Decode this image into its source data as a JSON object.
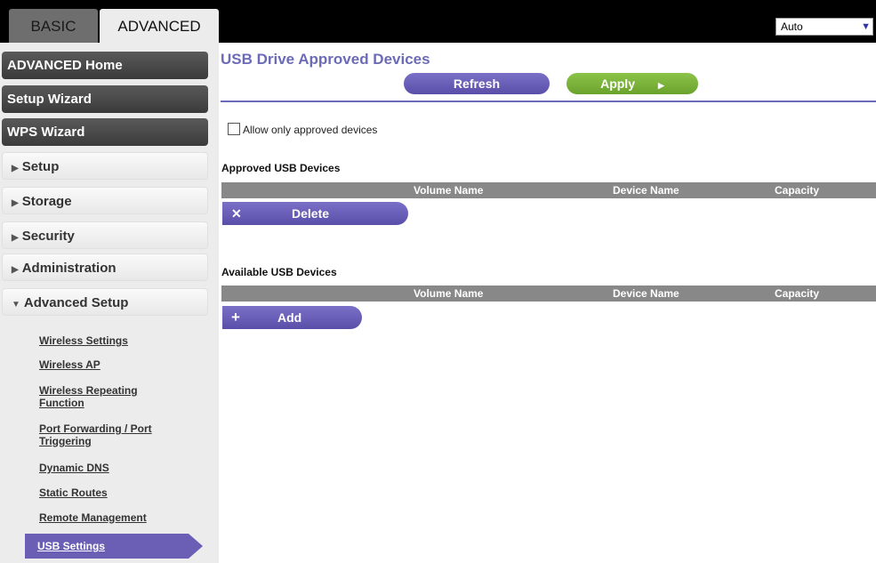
{
  "tabs": {
    "basic": "BASIC",
    "advanced": "ADVANCED"
  },
  "language": {
    "selected": "Auto"
  },
  "sidebar": {
    "advanced_home": "ADVANCED Home",
    "setup_wizard": "Setup Wizard",
    "wps_wizard": "WPS Wizard",
    "setup": "Setup",
    "storage": "Storage",
    "security": "Security",
    "administration": "Administration",
    "advanced_setup": "Advanced Setup",
    "submenu": {
      "wireless_settings": "Wireless Settings",
      "wireless_ap": "Wireless AP",
      "wireless_repeating": "Wireless Repeating Function",
      "port_forwarding": "Port Forwarding / Port Triggering",
      "dynamic_dns": "Dynamic DNS",
      "static_routes": "Static Routes",
      "remote_management": "Remote Management",
      "usb_settings": "USB Settings"
    }
  },
  "main": {
    "title": "USB Drive Approved Devices",
    "refresh": "Refresh",
    "apply": "Apply",
    "allow_only": "Allow only approved devices",
    "approved": {
      "title": "Approved USB Devices",
      "columns": [
        "Volume Name",
        "Device Name",
        "Capacity"
      ],
      "delete": "Delete"
    },
    "available": {
      "title": "Available USB Devices",
      "columns": [
        "Volume Name",
        "Device Name",
        "Capacity"
      ],
      "add": "Add"
    }
  },
  "colors": {
    "accent": "#6b6bb8",
    "button_purple": "#5a4fa8",
    "button_green": "#6aa22c"
  }
}
